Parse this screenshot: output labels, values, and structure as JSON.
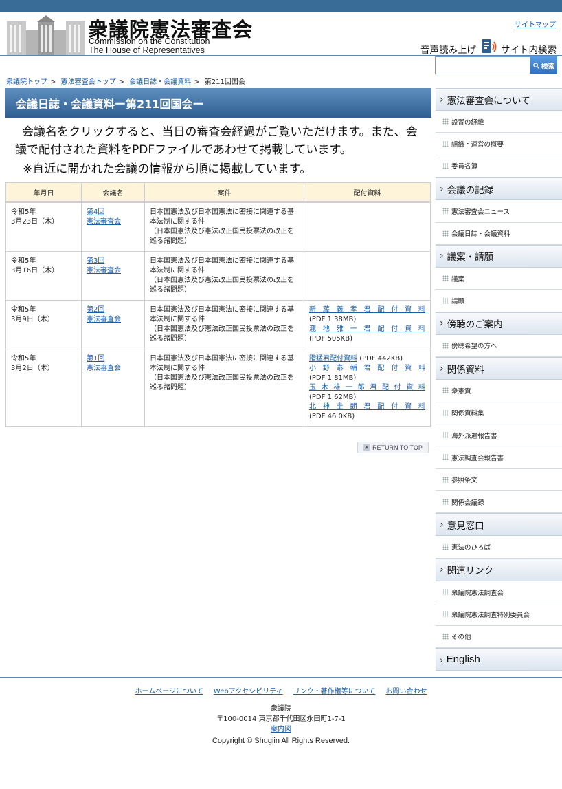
{
  "header": {
    "title_ja": "衆議院憲法審査会",
    "title_en_1": "Commission on the Constitution",
    "title_en_2": "The House of  Representatives",
    "sitemap": "サイトマップ",
    "speak": "音声読み上げ",
    "site_search": "サイト内検索",
    "search_placeholder": "",
    "search_button": "検索"
  },
  "breadcrumb": [
    "衆議院トップ",
    "憲法審査会トップ",
    "会議日誌・会議資料",
    "第211回国会"
  ],
  "page_title": "会議日誌・会議資料ー第211回国会ー",
  "intro": "会議名をクリックすると、当日の審査会経過がご覧いただけます。また、会議で配付された資料をPDFファイルであわせて掲載しています。",
  "intro_note": "※直近に開かれた会議の情報から順に掲載しています。",
  "table": {
    "headers": [
      "年月日",
      "会議名",
      "案件",
      "配付資料"
    ],
    "rows": [
      {
        "date1": "令和5年",
        "date2": "3月23日（木）",
        "meeting1": "第4回",
        "meeting2": "憲法審査会",
        "case1": "日本国憲法及び日本国憲法に密接に関連する基本法制に関する件",
        "case2": "（日本国憲法及び憲法改正国民投票法の改正を巡る諸問題）",
        "docs": []
      },
      {
        "date1": "令和5年",
        "date2": "3月16日（木）",
        "meeting1": "第3回",
        "meeting2": "憲法審査会",
        "case1": "日本国憲法及び日本国憲法に密接に関連する基本法制に関する件",
        "case2": "（日本国憲法及び憲法改正国民投票法の改正を巡る諸問題）",
        "docs": []
      },
      {
        "date1": "令和5年",
        "date2": "3月9日（木）",
        "meeting1": "第2回",
        "meeting2": "憲法審査会",
        "case1": "日本国憲法及び日本国憲法に密接に関連する基本法制に関する件",
        "case2": "（日本国憲法及び憲法改正国民投票法の改正を巡る諸問題）",
        "docs": [
          {
            "name": "新藤義孝君配付資料",
            "size": "(PDF 1.38MB)"
          },
          {
            "name": "瀧地雅一君配付資料",
            "size": "(PDF 505KB)"
          }
        ]
      },
      {
        "date1": "令和5年",
        "date2": "3月2日（木）",
        "meeting1": "第1回",
        "meeting2": "憲法審査会",
        "case1": "日本国憲法及び日本国憲法に密接に関連する基本法制に関する件",
        "case2": "（日本国憲法及び憲法改正国民投票法の改正を巡る諸問題）",
        "docs": [
          {
            "name": "階猛君配付資料",
            "size": "(PDF 442KB)"
          },
          {
            "name": "小野泰輔君配付資料",
            "size": "(PDF 1.81MB)"
          },
          {
            "name": "玉木雄一郎君配付資料",
            "size": "(PDF 1.62MB)"
          },
          {
            "name": "北神圭朗君配付資料",
            "size": "(PDF 46.0KB)"
          }
        ]
      }
    ]
  },
  "return_top": "RETURN TO TOP",
  "sidebar": {
    "sections": [
      {
        "title": "憲法審査会について",
        "items": [
          "設置の経緯",
          "組織・運営の概要",
          "委員名簿"
        ]
      },
      {
        "title": "会議の記録",
        "items": [
          "憲法審査会ニュース",
          "会議日誌・会議資料"
        ]
      },
      {
        "title": "議案・請願",
        "items": [
          "議案",
          "請願"
        ]
      },
      {
        "title": "傍聴のご案内",
        "items": [
          "傍聴希望の方へ"
        ]
      },
      {
        "title": "関係資料",
        "items": [
          "衆憲資",
          "関係資料集",
          "海外派遣報告書",
          "憲法調査会報告書",
          "参照条文",
          "関係会議録"
        ]
      },
      {
        "title": "意見窓口",
        "items": [
          "憲法のひろば"
        ]
      },
      {
        "title": "関連リンク",
        "items": [
          "衆議院憲法調査会",
          "衆議院憲法調査特別委員会",
          "その他"
        ]
      },
      {
        "title": "English",
        "items": []
      }
    ]
  },
  "footer": {
    "links": [
      "ホームページについて",
      "Webアクセシビリティ",
      "リンク・著作権等について",
      "お問い合わせ"
    ],
    "org": "衆議院",
    "address": "〒100-0014 東京都千代田区永田町1-7-1",
    "map": "案内図",
    "copyright": "Copyright © Shugiin All Rights Reserved."
  },
  "colors": {
    "header_bar": "#3a6c98",
    "title_bar": "#2f5f91",
    "table_head": "#fdf4d9",
    "link": "#1a5ea8"
  }
}
